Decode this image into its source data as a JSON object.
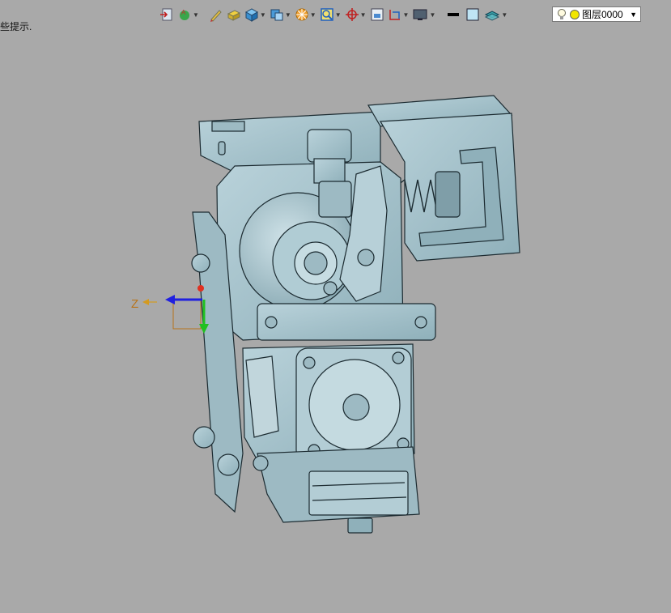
{
  "status": {
    "hint": "些提示."
  },
  "toolbar": {
    "items": [
      {
        "icon": "import-icon"
      },
      {
        "icon": "assembly-icon",
        "dropdown": true
      },
      {
        "icon": "sketch-pen-icon"
      },
      {
        "icon": "extrude-icon"
      },
      {
        "icon": "solid-cube-icon",
        "dropdown": true
      },
      {
        "icon": "display-style-icon",
        "dropdown": true
      },
      {
        "icon": "section-view-icon",
        "dropdown": true
      },
      {
        "icon": "zoom-fit-icon",
        "dropdown": true
      },
      {
        "icon": "orient-view-icon",
        "dropdown": true
      },
      {
        "icon": "measure-icon"
      },
      {
        "icon": "dimension-icon",
        "dropdown": true
      },
      {
        "icon": "screen-icon",
        "dropdown": true
      },
      {
        "icon": "line-color-icon"
      },
      {
        "icon": "fill-color-icon"
      },
      {
        "icon": "layer-stack-icon",
        "dropdown": true
      }
    ],
    "layer_selector": {
      "value": "图层0000",
      "bulb_color": "#f2e600"
    }
  },
  "triad": {
    "z_label": "Z"
  },
  "colors": {
    "background": "#a9a9a9",
    "model": "#a8c3cc",
    "model_dark": "#7f9ea8",
    "edge": "#1b2a30"
  }
}
